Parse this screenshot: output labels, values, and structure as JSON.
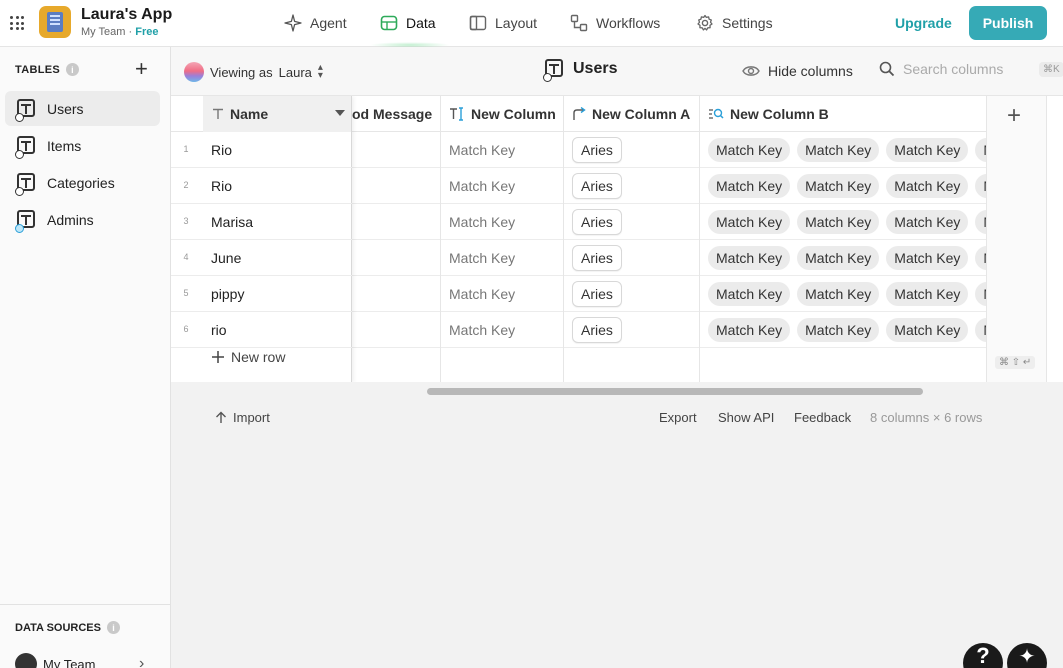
{
  "app": {
    "name": "Laura's App",
    "team": "My Team",
    "separator": "·",
    "plan": "Free"
  },
  "nav": {
    "agent": "Agent",
    "data": "Data",
    "layout": "Layout",
    "workflows": "Workflows",
    "settings": "Settings",
    "upgrade": "Upgrade",
    "publish": "Publish"
  },
  "sidebar": {
    "tables_heading": "TABLES",
    "info": "i",
    "items": [
      {
        "label": "Users"
      },
      {
        "label": "Items"
      },
      {
        "label": "Categories"
      },
      {
        "label": "Admins"
      }
    ],
    "data_sources_heading": "DATA SOURCES",
    "team_label": "My Team"
  },
  "toolbar": {
    "viewing_prefix": "Viewing as",
    "viewing_user": "Laura",
    "table_title": "Users",
    "hide_columns": "Hide columns",
    "search_placeholder": "Search columns",
    "search_shortcut": "⌘K"
  },
  "grid": {
    "columns": {
      "name": "Name",
      "mood": "od Message",
      "new_column": "New Column",
      "new_column_a": "New Column A",
      "new_column_b": "New Column B"
    },
    "rows": [
      {
        "num": "1",
        "name": "Rio",
        "new_column": "Match Key",
        "new_column_a": "Aries",
        "b1": "Match Key",
        "b2": "Match Key",
        "b3": "Match Key",
        "b4": "Match Key"
      },
      {
        "num": "2",
        "name": "Rio",
        "new_column": "Match Key",
        "new_column_a": "Aries",
        "b1": "Match Key",
        "b2": "Match Key",
        "b3": "Match Key",
        "b4": "Match Key"
      },
      {
        "num": "3",
        "name": "Marisa",
        "new_column": "Match Key",
        "new_column_a": "Aries",
        "b1": "Match Key",
        "b2": "Match Key",
        "b3": "Match Key",
        "b4": "Match Key"
      },
      {
        "num": "4",
        "name": "June",
        "new_column": "Match Key",
        "new_column_a": "Aries",
        "b1": "Match Key",
        "b2": "Match Key",
        "b3": "Match Key",
        "b4": "Match Key"
      },
      {
        "num": "5",
        "name": "pippy",
        "new_column": "Match Key",
        "new_column_a": "Aries",
        "b1": "Match Key",
        "b2": "Match Key",
        "b3": "Match Key",
        "b4": "Match Key"
      },
      {
        "num": "6",
        "name": "rio",
        "new_column": "Match Key",
        "new_column_a": "Aries",
        "b1": "Match Key",
        "b2": "Match Key",
        "b3": "Match Key",
        "b4": "Match Key"
      }
    ],
    "new_row": "New row",
    "add_column_shortcut": "⌘ ⇧ ↵"
  },
  "footer": {
    "import": "Import",
    "export": "Export",
    "show_api": "Show API",
    "feedback": "Feedback",
    "stats": "8 columns × 6 rows"
  },
  "floating": {
    "help": "?",
    "ai": "✦"
  },
  "colors": {
    "accent": "#36aab6",
    "plan": "#20a0a8",
    "app_logo": "#e7a92b"
  }
}
